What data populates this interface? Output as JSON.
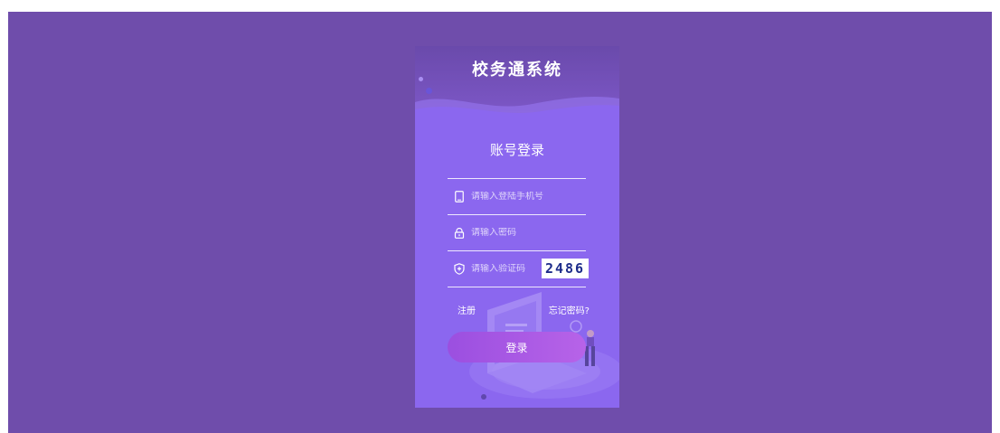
{
  "header": {
    "system_title": "校务通系统"
  },
  "login": {
    "title": "账号登录",
    "phone_placeholder": "请输入登陆手机号",
    "password_placeholder": "请输入密码",
    "captcha_placeholder": "请输入验证码",
    "captcha_code": "2486",
    "register_label": "注册",
    "forgot_label": "忘记密码?",
    "submit_label": "登录"
  },
  "icons": {
    "phone": "phone-icon",
    "lock": "lock-icon",
    "shield": "shield-icon"
  },
  "colors": {
    "page_background": "#6f4dab",
    "card_background": "#8b67ef",
    "button_gradient_start": "#9b4fe0",
    "button_gradient_end": "#b763e8",
    "captcha_text": "#1d2c8a"
  }
}
